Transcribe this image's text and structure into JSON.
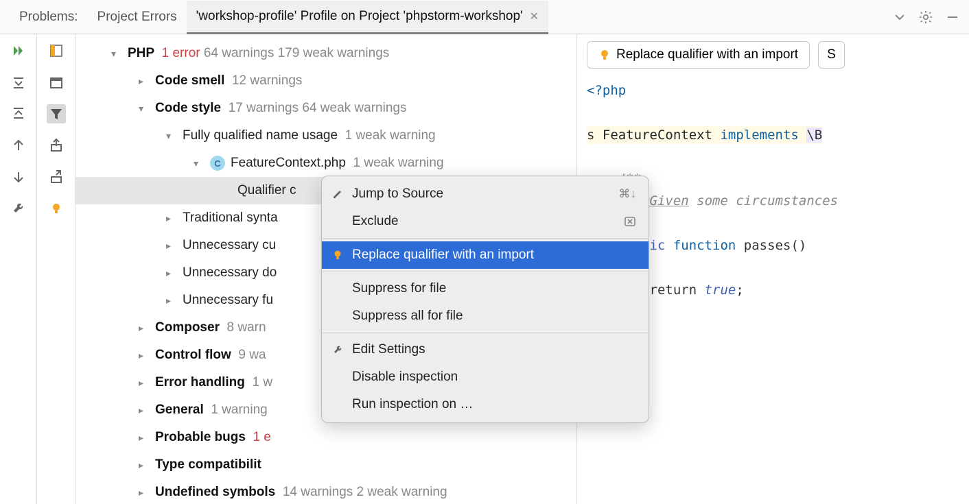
{
  "tabs": {
    "problems_label": "Problems:",
    "project_errors": "Project Errors",
    "active": "'workshop-profile' Profile on Project 'phpstorm-workshop'"
  },
  "tree": {
    "php_group": {
      "label": "PHP",
      "err": "1 error",
      "warn": "64 warnings 179 weak warnings"
    },
    "code_smell": {
      "label": "Code smell",
      "warn": "12 warnings"
    },
    "code_style": {
      "label": "Code style",
      "warn": "17 warnings 64 weak warnings"
    },
    "fq": {
      "label": "Fully qualified name usage",
      "warn": "1 weak warning"
    },
    "file": {
      "label": "FeatureContext.php",
      "warn": "1 weak warning"
    },
    "qualifier": {
      "label": "Qualifier c"
    },
    "traditional": {
      "label": "Traditional synta"
    },
    "unnecessary_cu": {
      "label": "Unnecessary cu"
    },
    "unnecessary_do": {
      "label": "Unnecessary do"
    },
    "unnecessary_fu": {
      "label": "Unnecessary fu"
    },
    "composer": {
      "label": "Composer",
      "warn": "8 warn"
    },
    "control_flow": {
      "label": "Control flow",
      "warn": "9 wa"
    },
    "error_handling": {
      "label": "Error handling",
      "warn": "1 w"
    },
    "general": {
      "label": "General",
      "warn": "1 warning"
    },
    "probable_bugs": {
      "label": "Probable bugs",
      "err": "1 e"
    },
    "type_compat": {
      "label": "Type compatibilit"
    },
    "undef": {
      "label": "Undefined symbols",
      "warn": "14 warnings 2 weak warning"
    }
  },
  "context_menu": {
    "jump": "Jump to Source",
    "jump_shortcut": "⌘↓",
    "exclude": "Exclude",
    "replace": "Replace qualifier with an import",
    "suppress_file": "Suppress for file",
    "suppress_all": "Suppress all for file",
    "edit_settings": "Edit Settings",
    "disable": "Disable inspection",
    "run_on": "Run inspection on …"
  },
  "quickfix": {
    "replace_label": "Replace qualifier with an import",
    "s_label": "S"
  },
  "code": {
    "php_open": "<?php",
    "line_class": "s ",
    "classname": "FeatureContext",
    "implements": " implements ",
    "ns": "\\B",
    "doc1": "/**",
    "doc2": " * ",
    "ann": "@Given",
    "doc2b": " some circumstances",
    "doc3": " */",
    "pub": "public",
    "func": " function ",
    "fn": "passes",
    "parens": "()",
    "ob": "{",
    "ret": "    return ",
    "true": "true",
    "semi": ";",
    "cb": "}"
  }
}
